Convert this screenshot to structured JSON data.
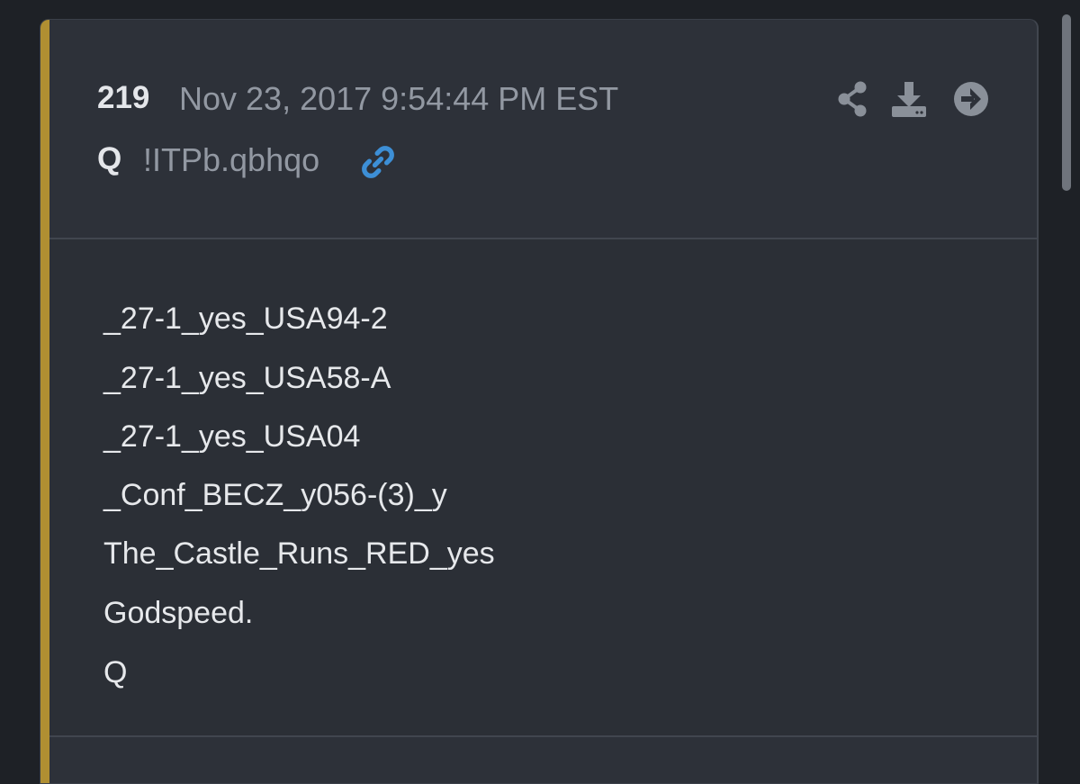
{
  "post": {
    "number": "219",
    "timestamp": "Nov 23, 2017 9:54:44 PM EST",
    "author": "Q",
    "tripcode": "!ITPb.qbhqo",
    "lines": [
      "_27-1_yes_USA94-2",
      "_27-1_yes_USA58-A",
      "_27-1_yes_USA04",
      "_Conf_BECZ_y056-(3)_y",
      "The_Castle_Runs_RED_yes",
      "Godspeed.",
      "Q"
    ]
  },
  "icons": {
    "link": "link-icon",
    "share": "share-icon",
    "download": "download-icon",
    "forward": "arrow-right-circle-icon"
  },
  "colors": {
    "accent": "#b08f32",
    "link": "#3d8fd6",
    "card": "#2d3139",
    "text": "#e6e8eb",
    "muted": "#9298a2"
  }
}
